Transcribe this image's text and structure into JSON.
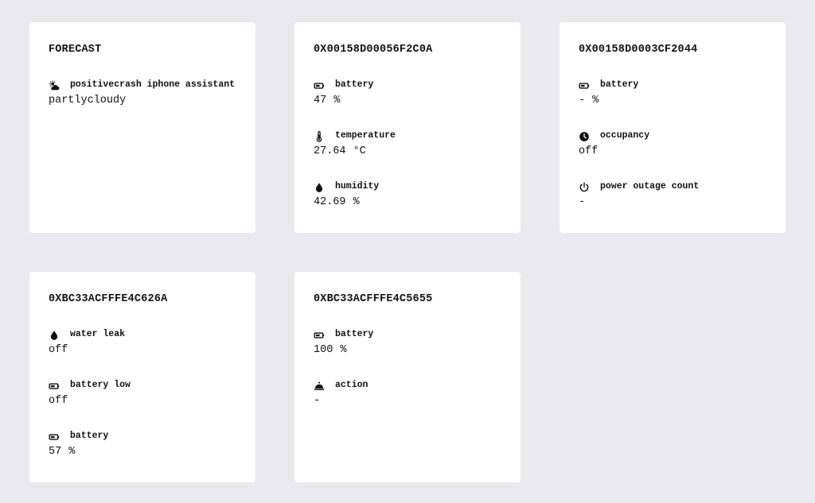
{
  "cards": [
    {
      "title": "FORECAST",
      "entities": [
        {
          "icon": "partly-cloudy-icon",
          "name": "positivecrash iphone assistant",
          "value": "partlycloudy",
          "unit": ""
        }
      ]
    },
    {
      "title": "0X00158D00056F2C0A",
      "entities": [
        {
          "icon": "battery-icon",
          "name": "battery",
          "value": "47",
          "unit": "%"
        },
        {
          "icon": "thermometer-icon",
          "name": "temperature",
          "value": "27.64",
          "unit": "°C"
        },
        {
          "icon": "water-drop-icon",
          "name": "humidity",
          "value": "42.69",
          "unit": "%"
        }
      ]
    },
    {
      "title": "0X00158D0003CF2044",
      "entities": [
        {
          "icon": "battery-icon",
          "name": "battery",
          "value": "-",
          "unit": "%"
        },
        {
          "icon": "clock-icon",
          "name": "occupancy",
          "value": "off",
          "unit": ""
        },
        {
          "icon": "power-icon",
          "name": "power outage count",
          "value": "-",
          "unit": ""
        }
      ]
    },
    {
      "title": "0XBC33ACFFFE4C626A",
      "entities": [
        {
          "icon": "water-drop-icon",
          "name": "water leak",
          "value": "off",
          "unit": ""
        },
        {
          "icon": "battery-icon",
          "name": "battery low",
          "value": "off",
          "unit": ""
        },
        {
          "icon": "battery-icon",
          "name": "battery",
          "value": "57",
          "unit": "%"
        }
      ]
    },
    {
      "title": "0XBC33ACFFFE4C5655",
      "entities": [
        {
          "icon": "battery-icon",
          "name": "battery",
          "value": "100",
          "unit": "%"
        },
        {
          "icon": "bell-icon",
          "name": "action",
          "value": "-",
          "unit": ""
        }
      ]
    }
  ],
  "colors": {
    "background": "#e9e9ee",
    "card": "#ffffff",
    "text": "#111111"
  }
}
